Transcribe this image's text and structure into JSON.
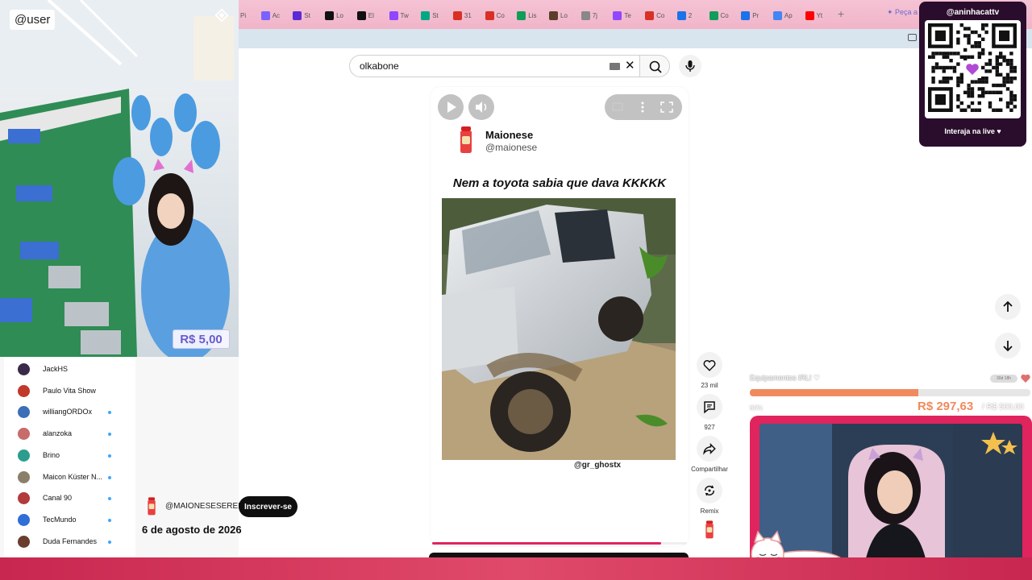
{
  "browser": {
    "tabs": [
      {
        "label": "Pi",
        "color": "#1da1f2"
      },
      {
        "label": "Ac",
        "color": "#7b61ff"
      },
      {
        "label": "St",
        "color": "#5b2bd6"
      },
      {
        "label": "Lo",
        "color": "#111111"
      },
      {
        "label": "El",
        "color": "#111111"
      },
      {
        "label": "Tw",
        "color": "#9146ff"
      },
      {
        "label": "St",
        "color": "#00a884"
      },
      {
        "label": "31",
        "color": "#d93025"
      },
      {
        "label": "Co",
        "color": "#d93025"
      },
      {
        "label": "Lis",
        "color": "#0f9d58"
      },
      {
        "label": "Lo",
        "color": "#5a3e2b"
      },
      {
        "label": "7j",
        "color": "#888888"
      },
      {
        "label": "Te",
        "color": "#9146ff"
      },
      {
        "label": "Co",
        "color": "#d93025"
      },
      {
        "label": "2",
        "color": "#1a73e8"
      },
      {
        "label": "Co",
        "color": "#0f9d58"
      },
      {
        "label": "Pr",
        "color": "#1a73e8"
      },
      {
        "label": "Ap",
        "color": "#4285f4"
      },
      {
        "label": "Yt",
        "color": "#ff0000"
      }
    ],
    "gemini_label": "✦ Peça a"
  },
  "search": {
    "query": "olkabone"
  },
  "short": {
    "channel_name": "Maionese",
    "channel_handle": "@maionese",
    "caption": "Nem a toyota sabia que dava KKKKK",
    "watermark": "@gr_ghostx",
    "progress": 0.9,
    "actions": [
      {
        "id": "like",
        "label": "23 mil"
      },
      {
        "id": "comment",
        "label": "927"
      },
      {
        "id": "share",
        "label": "Compartilhar"
      },
      {
        "id": "remix",
        "label": "Remix"
      }
    ]
  },
  "subscribe_row": {
    "handle": "@MAIONESESEREIO",
    "button_label": "Inscrever-se",
    "date": "6 de agosto de 2026"
  },
  "sidebar": {
    "subscriptions": [
      {
        "name": "JackHS",
        "color": "#3a2a4a",
        "dot": false
      },
      {
        "name": "Paulo Vita Show",
        "color": "#c0392b",
        "dot": false
      },
      {
        "name": "williangORDOx",
        "color": "#3d6fb6",
        "dot": true
      },
      {
        "name": "alanzoka",
        "color": "#c76b6b",
        "dot": true
      },
      {
        "name": "Brino",
        "color": "#2a9d8f",
        "dot": true
      },
      {
        "name": "Maicon Küster N...",
        "color": "#8a7f6a",
        "dot": true
      },
      {
        "name": "Canal 90",
        "color": "#b23b3b",
        "dot": true
      },
      {
        "name": "TecMundo",
        "color": "#2f6fd6",
        "dot": true
      },
      {
        "name": "Duda Fernandes",
        "color": "#6b3d2f",
        "dot": true
      }
    ]
  },
  "overlay": {
    "user_tag": "@user",
    "price": "R$ 5,00",
    "qr_title": "@aninhacattv",
    "qr_subtitle": "Interaja na live ♥",
    "goal_title": "Equipamentos IRL! ♡",
    "goal_pill": "30d 18h",
    "goal_percent": "60%",
    "goal_progress": 0.6,
    "goal_amount": "R$ 297,63",
    "goal_target": "/ R$ 500,00"
  }
}
